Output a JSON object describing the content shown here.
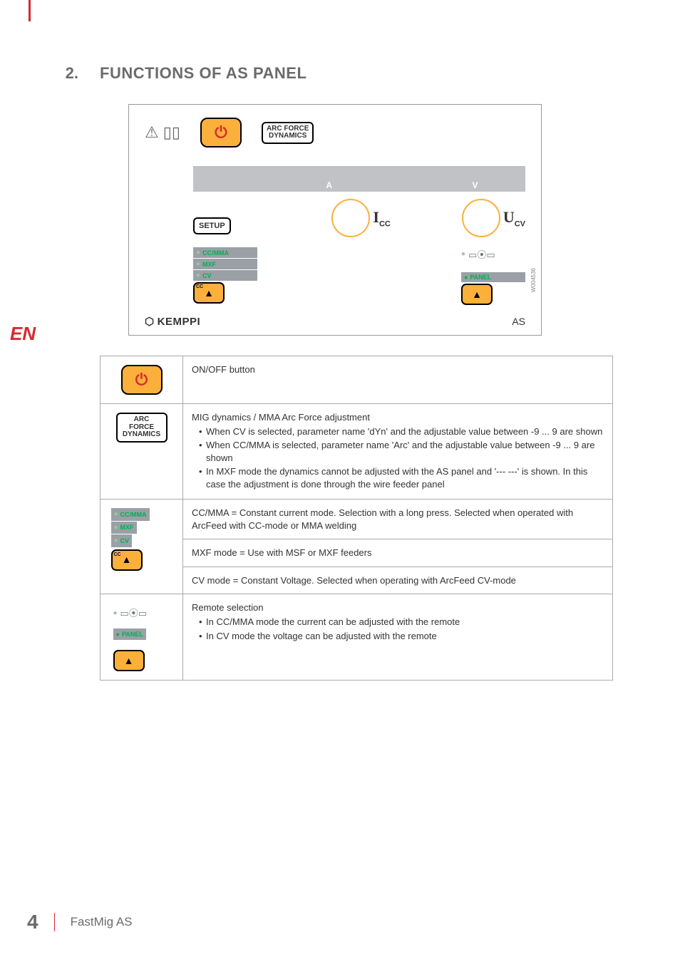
{
  "heading": {
    "num": "2.",
    "text": "FUNCTIONS OF AS PANEL"
  },
  "panel": {
    "arcforce_l1": "ARC FORCE",
    "arcforce_l2": "DYNAMICS",
    "disp_a": "A",
    "disp_v": "V",
    "knob_i": "I",
    "knob_i_sub": "CC",
    "knob_u": "U",
    "knob_u_sub": "CV",
    "setup": "SETUP",
    "mode_cc": "CC/MMA",
    "mode_mxf": "MXF",
    "mode_cv": "CV",
    "cc_tiny": "CC",
    "panel_label": "PANEL",
    "brand": "KEMPPI",
    "model": "AS",
    "rotcode": "W004536"
  },
  "rows": {
    "r1": {
      "text": "ON/OFF button"
    },
    "r2": {
      "title": "MIG dynamics / MMA Arc Force adjustment",
      "b1": "When CV is selected, parameter name 'dYn' and the adjustable value between -9 ... 9 are shown",
      "b2": "When CC/MMA is selected, parameter name 'Arc' and the adjustable value between -9 ... 9 are shown",
      "b3": "In MXF mode the dynamics cannot be adjusted with the AS panel and '--- ---' is shown. In this case the adjustment is done through the wire feeder panel"
    },
    "r3a": "CC/MMA = Constant current mode. Selection with a long press. Selected when operated with ArcFeed with CC-mode or MMA welding",
    "r3b": "MXF mode = Use with MSF or MXF feeders",
    "r3c": "CV mode = Constant Voltage. Selected when operating with ArcFeed CV-mode",
    "r4": {
      "title": "Remote selection",
      "b1": "In CC/MMA mode the current can be adjusted with the remote",
      "b2": "In CV mode the voltage can be adjusted with the remote"
    }
  },
  "side": "EN",
  "footer": {
    "page": "4",
    "doc": "FastMig AS"
  }
}
